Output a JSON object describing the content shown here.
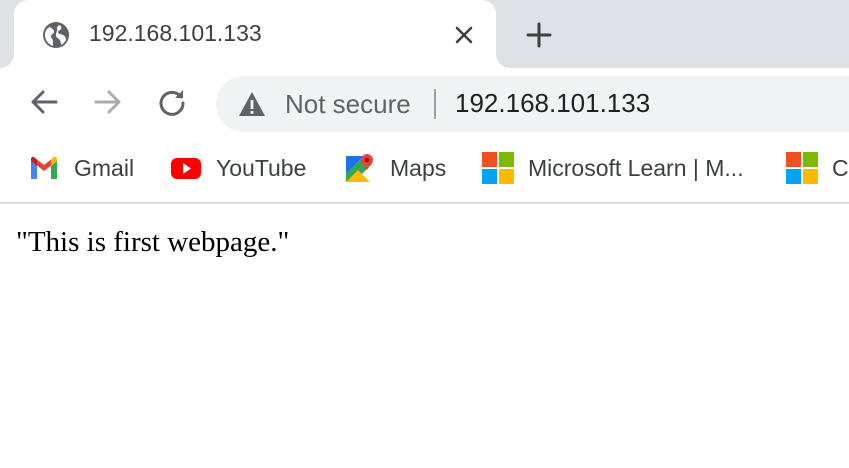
{
  "tab": {
    "title": "192.168.101.133",
    "favicon": "globe-icon",
    "close_icon": "close-icon",
    "new_tab_icon": "plus-icon"
  },
  "toolbar": {
    "back_icon": "back-arrow-icon",
    "forward_icon": "forward-arrow-icon",
    "reload_icon": "reload-icon",
    "security_icon": "warning-triangle-icon",
    "security_label": "Not secure",
    "url": "192.168.101.133"
  },
  "bookmarks": [
    {
      "label": "Gmail",
      "icon": "gmail-icon"
    },
    {
      "label": "YouTube",
      "icon": "youtube-icon"
    },
    {
      "label": "Maps",
      "icon": "maps-icon"
    },
    {
      "label": "Microsoft Learn | M...",
      "icon": "microsoft-icon"
    },
    {
      "label": "C",
      "icon": "microsoft-icon"
    }
  ],
  "page": {
    "content": "\"This is first webpage.\""
  },
  "colors": {
    "tabstrip": "#dee1e6",
    "omnibox": "#f1f3f4",
    "text": "#202124",
    "muted": "#5f6368"
  }
}
